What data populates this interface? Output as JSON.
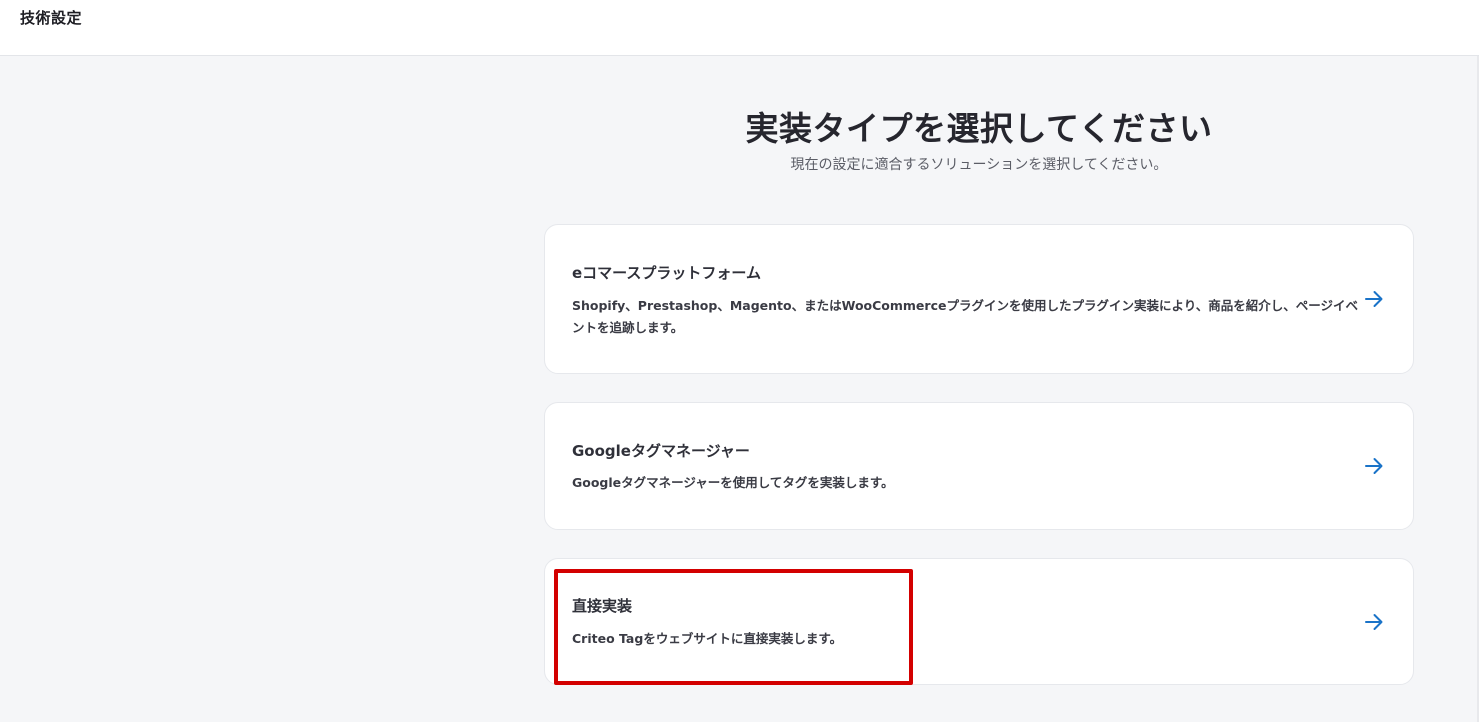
{
  "header": {
    "title": "技術設定"
  },
  "main": {
    "heading": "実装タイプを選択してください",
    "subheading": "現在の設定に適合するソリューションを選択してください。"
  },
  "options": [
    {
      "title": "eコマースプラットフォーム",
      "description": "Shopify、Prestashop、Magento、またはWooCommerceプラグインを使用したプラグイン実装により、商品を紹介し、ページイベントを追跡します。",
      "icon": "arrow-right-icon"
    },
    {
      "title": "Googleタグマネージャー",
      "description": "Googleタグマネージャーを使用してタグを実装します。",
      "icon": "arrow-right-icon"
    },
    {
      "title": "直接実装",
      "description": "Criteo Tagをウェブサイトに直接実装します。",
      "icon": "arrow-right-icon"
    }
  ],
  "colors": {
    "accent": "#1a73c8",
    "highlight": "#d30000",
    "background": "#f5f6f8"
  }
}
